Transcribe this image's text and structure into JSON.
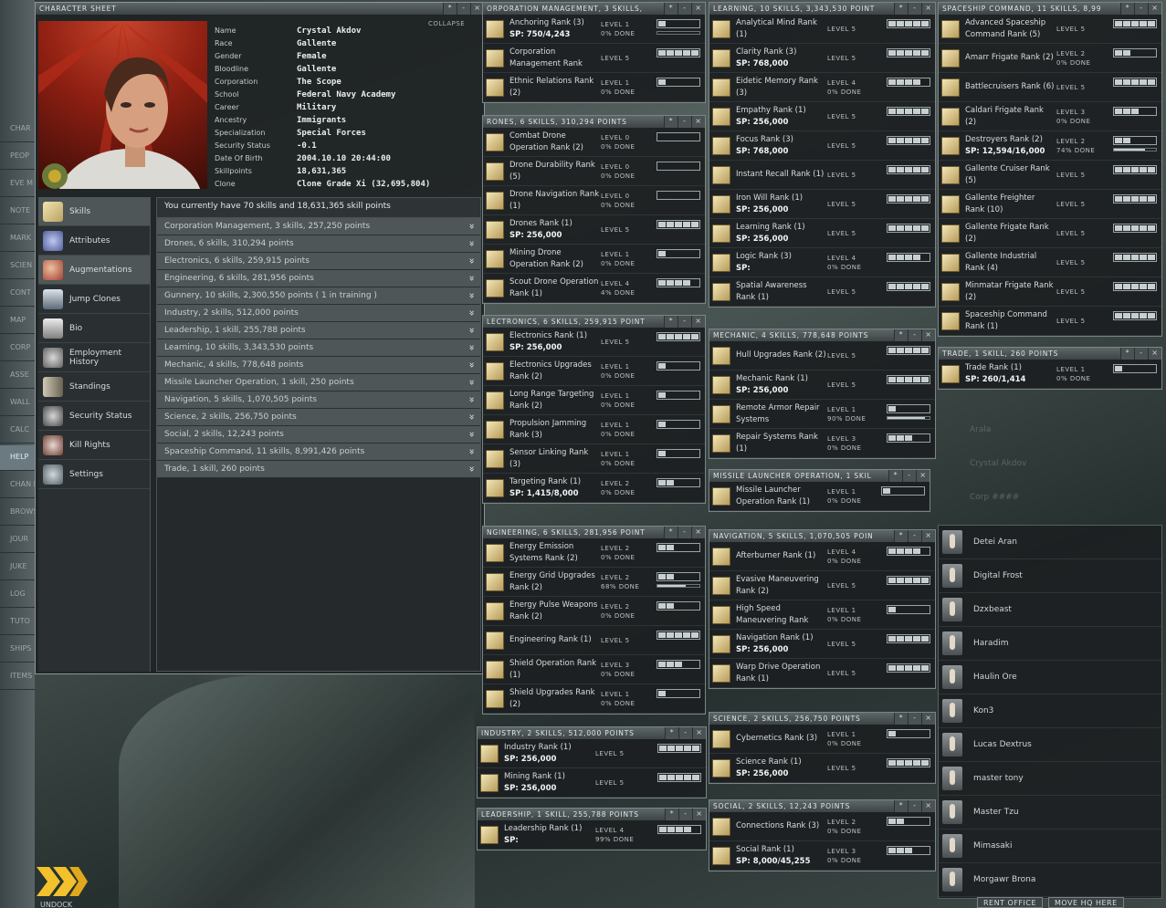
{
  "sidebar": [
    "CHAR",
    "PEOP",
    "EVE M",
    "NOTE",
    "MARK",
    "SCIEN INDUS",
    "CONT",
    "MAP",
    "CORP",
    "ASSE",
    "WALL",
    "CALC",
    "HELP",
    "CHAN MAILI",
    "BROWS",
    "JOUR",
    "JUKE",
    "LOG",
    "TUTO",
    "SHIPS",
    "ITEMS"
  ],
  "undock": {
    "label": "UNDOCK"
  },
  "character": {
    "title": "CHARACTER SHEET",
    "collapse": "COLLAPSE",
    "info": [
      [
        "Name",
        "Crystal Akdov"
      ],
      [
        "Race",
        "Gallente"
      ],
      [
        "Gender",
        "Female"
      ],
      [
        "Bloodline",
        "Gallente"
      ],
      [
        "Corporation",
        "The Scope"
      ],
      [
        "School",
        "Federal Navy Academy"
      ],
      [
        "Career",
        "Military"
      ],
      [
        "Ancestry",
        "Immigrants"
      ],
      [
        "Specialization",
        "Special Forces"
      ],
      [
        "Security Status",
        "-0.1"
      ],
      [
        "Date Of Birth",
        "2004.10.10 20:44:00"
      ],
      [
        "Skillpoints",
        "18,631,365"
      ],
      [
        "Clone",
        "Clone Grade Xi (32,695,804)"
      ]
    ],
    "nav": [
      {
        "label": "Skills",
        "icon": "book-icon"
      },
      {
        "label": "Attributes",
        "icon": "attributes-icon"
      },
      {
        "label": "Augmentations",
        "icon": "augmentations-icon"
      },
      {
        "label": "Jump Clones",
        "icon": "clones-icon"
      },
      {
        "label": "Bio",
        "icon": "bio-icon"
      },
      {
        "label": "Employment History",
        "icon": "employment-icon"
      },
      {
        "label": "Standings",
        "icon": "standings-icon"
      },
      {
        "label": "Security Status",
        "icon": "security-icon"
      },
      {
        "label": "Kill Rights",
        "icon": "kill-icon"
      },
      {
        "label": "Settings",
        "icon": "settings-icon"
      }
    ],
    "skills_header": "You currently have 70 skills and 18,631,365 skill points",
    "skill_groups": [
      "Corporation Management, 3 skills, 257,250 points",
      "Drones, 6 skills, 310,294 points",
      "Electronics, 6 skills, 259,915 points",
      "Engineering, 6 skills, 281,956 points",
      "Gunnery, 10 skills, 2,300,550 points ( 1 in training )",
      "Industry, 2 skills, 512,000 points",
      "Leadership, 1 skill, 255,788 points",
      "Learning, 10 skills, 3,343,530 points",
      "Mechanic, 4 skills, 778,648 points",
      "Missile Launcher Operation, 1 skill, 250 points",
      "Navigation, 5 skills, 1,070,505 points",
      "Science, 2 skills, 256,750 points",
      "Social, 2 skills, 12,243 points",
      "Spaceship Command, 11 skills, 8,991,426 points",
      "Trade, 1 skill, 260 points"
    ]
  },
  "groups": [
    {
      "title": "ORPORATION MANAGEMENT, 3 SKILLS,",
      "skills": [
        {
          "n": "Anchoring Rank (3)",
          "sp": "SP: 750/4,243",
          "lv": "LEVEL 1",
          "d": "0% DONE",
          "b": 1,
          "p": 0
        },
        {
          "n": "Corporation Management Rank",
          "lv": "LEVEL 5",
          "b": 5
        },
        {
          "n": "Ethnic Relations Rank (2)",
          "lv": "LEVEL 1",
          "d": "0% DONE",
          "b": 1
        }
      ]
    },
    {
      "title": "RONES, 6 SKILLS, 310,294 POINTS",
      "skills": [
        {
          "n": "Combat Drone Operation Rank (2)",
          "lv": "LEVEL 0",
          "d": "0% DONE",
          "b": 0
        },
        {
          "n": "Drone Durability Rank (5)",
          "lv": "LEVEL 0",
          "d": "0% DONE",
          "b": 0
        },
        {
          "n": "Drone Navigation Rank (1)",
          "lv": "LEVEL 0",
          "d": "0% DONE",
          "b": 0
        },
        {
          "n": "Drones Rank (1)",
          "sp": "SP: 256,000",
          "lv": "LEVEL 5",
          "b": 5
        },
        {
          "n": "Mining Drone Operation Rank (2)",
          "lv": "LEVEL 1",
          "d": "0% DONE",
          "b": 1
        },
        {
          "n": "Scout Drone Operation Rank (1)",
          "lv": "LEVEL 4",
          "d": "4% DONE",
          "b": 4
        }
      ]
    },
    {
      "title": "LECTRONICS, 6 SKILLS, 259,915 POINT",
      "skills": [
        {
          "n": "Electronics Rank (1)",
          "sp": "SP: 256,000",
          "lv": "LEVEL 5",
          "b": 5
        },
        {
          "n": "Electronics Upgrades Rank (2)",
          "lv": "LEVEL 1",
          "d": "0% DONE",
          "b": 1
        },
        {
          "n": "Long Range Targeting Rank (2)",
          "lv": "LEVEL 1",
          "d": "0% DONE",
          "b": 1
        },
        {
          "n": "Propulsion Jamming Rank (3)",
          "lv": "LEVEL 1",
          "d": "0% DONE",
          "b": 1
        },
        {
          "n": "Sensor Linking Rank (3)",
          "lv": "LEVEL 1",
          "d": "0% DONE",
          "b": 1
        },
        {
          "n": "Targeting Rank (1)",
          "sp": "SP: 1,415/8,000",
          "lv": "LEVEL 2",
          "d": "0% DONE",
          "b": 2
        }
      ]
    },
    {
      "title": "NGINEERING, 6 SKILLS, 281,956 POINT",
      "skills": [
        {
          "n": "Energy Emission Systems Rank (2)",
          "lv": "LEVEL 2",
          "d": "0% DONE",
          "b": 2
        },
        {
          "n": "Energy Grid Upgrades Rank (2)",
          "lv": "LEVEL 2",
          "d": "68% DONE",
          "b": 2,
          "p": 68
        },
        {
          "n": "Energy Pulse Weapons Rank (2)",
          "lv": "LEVEL 2",
          "d": "0% DONE",
          "b": 2
        },
        {
          "n": "Engineering Rank (1)",
          "lv": "LEVEL 5",
          "b": 5
        },
        {
          "n": "Shield Operation Rank (1)",
          "lv": "LEVEL 3",
          "d": "0% DONE",
          "b": 3
        },
        {
          "n": "Shield Upgrades Rank (2)",
          "lv": "LEVEL 1",
          "d": "0% DONE",
          "b": 1
        }
      ]
    },
    {
      "title": "INDUSTRY, 2 SKILLS, 512,000 POINTS",
      "skills": [
        {
          "n": "Industry Rank (1)",
          "sp": "SP: 256,000",
          "lv": "LEVEL 5",
          "b": 5
        },
        {
          "n": "Mining Rank (1)",
          "sp": "SP: 256,000",
          "lv": "LEVEL 5",
          "b": 5
        }
      ]
    },
    {
      "title": "LEADERSHIP, 1 SKILL, 255,788 POINTS",
      "skills": [
        {
          "n": "Leadership Rank (1)",
          "sp": "SP:",
          "lv": "LEVEL 4",
          "d": "99% DONE",
          "b": 4
        }
      ]
    },
    {
      "title": "LEARNING, 10 SKILLS, 3,343,530 POINT",
      "skills": [
        {
          "n": "Analytical Mind Rank (1)",
          "lv": "LEVEL 5",
          "b": 5
        },
        {
          "n": "Clarity Rank (3)",
          "sp": "SP: 768,000",
          "lv": "LEVEL 5",
          "b": 5
        },
        {
          "n": "Eidetic Memory Rank (3)",
          "lv": "LEVEL 4",
          "d": "0% DONE",
          "b": 4
        },
        {
          "n": "Empathy Rank (1)",
          "sp": "SP: 256,000",
          "lv": "LEVEL 5",
          "b": 5
        },
        {
          "n": "Focus Rank (3)",
          "sp": "SP: 768,000",
          "lv": "LEVEL 5",
          "b": 5
        },
        {
          "n": "Instant Recall Rank (1)",
          "lv": "LEVEL 5",
          "b": 5
        },
        {
          "n": "Iron Will Rank (1)",
          "sp": "SP: 256,000",
          "lv": "LEVEL 5",
          "b": 5
        },
        {
          "n": "Learning Rank (1)",
          "sp": "SP: 256,000",
          "lv": "LEVEL 5",
          "b": 5
        },
        {
          "n": "Logic Rank (3)",
          "sp": "SP:",
          "lv": "LEVEL 4",
          "d": "0% DONE",
          "b": 4
        },
        {
          "n": "Spatial Awareness Rank (1)",
          "lv": "LEVEL 5",
          "b": 5
        }
      ]
    },
    {
      "title": "MECHANIC, 4 SKILLS, 778,648 POINTS",
      "skills": [
        {
          "n": "Hull Upgrades Rank (2)",
          "lv": "LEVEL 5",
          "b": 5
        },
        {
          "n": "Mechanic Rank (1)",
          "sp": "SP: 256,000",
          "lv": "LEVEL 5",
          "b": 5
        },
        {
          "n": "Remote Armor Repair Systems",
          "lv": "LEVEL 1",
          "d": "90% DONE",
          "b": 1,
          "p": 90
        },
        {
          "n": "Repair Systems Rank (1)",
          "lv": "LEVEL 3",
          "d": "0% DONE",
          "b": 3
        }
      ]
    },
    {
      "title": "MISSILE LAUNCHER OPERATION, 1 SKIL",
      "skills": [
        {
          "n": "Missile Launcher Operation Rank (1)",
          "lv": "LEVEL 1",
          "d": "0% DONE",
          "b": 1
        }
      ]
    },
    {
      "title": "NAVIGATION, 5 SKILLS, 1,070,505 POIN",
      "skills": [
        {
          "n": "Afterburner Rank (1)",
          "lv": "LEVEL 4",
          "d": "0% DONE",
          "b": 4
        },
        {
          "n": "Evasive Maneuvering Rank (2)",
          "lv": "LEVEL 5",
          "b": 5
        },
        {
          "n": "High Speed Maneuvering Rank",
          "lv": "LEVEL 1",
          "d": "0% DONE",
          "b": 1
        },
        {
          "n": "Navigation Rank (1)",
          "sp": "SP: 256,000",
          "lv": "LEVEL 5",
          "b": 5
        },
        {
          "n": "Warp Drive Operation Rank (1)",
          "lv": "LEVEL 5",
          "b": 5
        }
      ]
    },
    {
      "title": "SCIENCE, 2 SKILLS, 256,750 POINTS",
      "skills": [
        {
          "n": "Cybernetics Rank (3)",
          "lv": "LEVEL 1",
          "d": "0% DONE",
          "b": 1
        },
        {
          "n": "Science Rank (1)",
          "sp": "SP: 256,000",
          "lv": "LEVEL 5",
          "b": 5
        }
      ]
    },
    {
      "title": "SOCIAL, 2 SKILLS, 12,243 POINTS",
      "skills": [
        {
          "n": "Connections Rank (3)",
          "lv": "LEVEL 2",
          "d": "0% DONE",
          "b": 2
        },
        {
          "n": "Social Rank (1)",
          "sp": "SP: 8,000/45,255",
          "lv": "LEVEL 3",
          "d": "0% DONE",
          "b": 3
        }
      ]
    },
    {
      "title": "SPACESHIP COMMAND, 11 SKILLS, 8,99",
      "skills": [
        {
          "n": "Advanced Spaceship Command Rank (5)",
          "lv": "LEVEL 5",
          "b": 5
        },
        {
          "n": "Amarr Frigate Rank (2)",
          "lv": "LEVEL 2",
          "d": "0% DONE",
          "b": 2
        },
        {
          "n": "Battlecruisers Rank (6)",
          "lv": "LEVEL 5",
          "b": 5
        },
        {
          "n": "Caldari Frigate Rank (2)",
          "lv": "LEVEL 3",
          "d": "0% DONE",
          "b": 3
        },
        {
          "n": "Destroyers Rank (2)",
          "sp": "SP: 12,594/16,000",
          "lv": "LEVEL 2",
          "d": "74% DONE",
          "b": 2,
          "p": 74
        },
        {
          "n": "Gallente Cruiser Rank (5)",
          "lv": "LEVEL 5",
          "b": 5
        },
        {
          "n": "Gallente Freighter Rank (10)",
          "lv": "LEVEL 5",
          "b": 5
        },
        {
          "n": "Gallente Frigate Rank (2)",
          "lv": "LEVEL 5",
          "b": 5
        },
        {
          "n": "Gallente Industrial Rank (4)",
          "lv": "LEVEL 5",
          "b": 5
        },
        {
          "n": "Minmatar Frigate Rank (2)",
          "lv": "LEVEL 5",
          "b": 5
        },
        {
          "n": "Spaceship Command Rank (1)",
          "lv": "LEVEL 5",
          "b": 5
        }
      ]
    },
    {
      "title": "TRADE, 1 SKILL, 260 POINTS",
      "skills": [
        {
          "n": "Trade Rank (1)",
          "sp": "SP: 260/1,414",
          "lv": "LEVEL 1",
          "d": "0% DONE",
          "b": 1
        }
      ]
    }
  ],
  "pilots": [
    "Detei Aran",
    "Digital Frost",
    "Dzxbeast",
    "Haradim",
    "Haulin Ore",
    "Kon3",
    "Lucas Dextrus",
    "master tony",
    "Master Tzu",
    "Mimasaki",
    "Morgawr Brona"
  ],
  "buttons": {
    "rent": "RENT OFFICE",
    "move": "MOVE HQ HERE"
  },
  "ghost": [
    "Arala",
    "Crystal Akdov",
    "Corp ####"
  ]
}
